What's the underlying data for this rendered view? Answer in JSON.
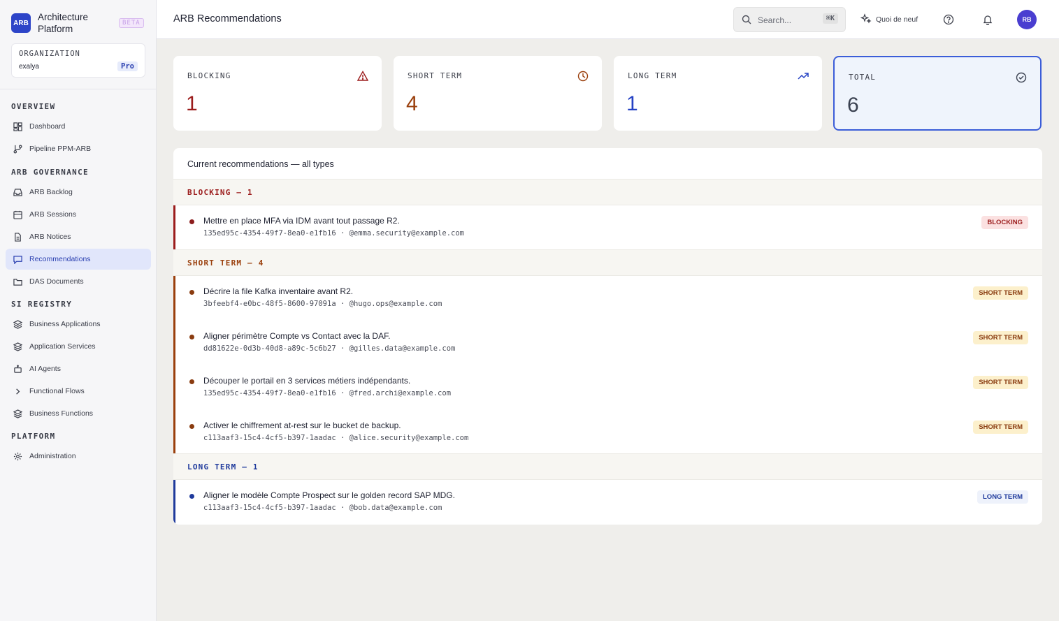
{
  "brand": {
    "logo": "ARB",
    "name": "Architecture Platform",
    "badge": "BETA"
  },
  "org": {
    "label": "ORGANIZATION",
    "name": "exalya",
    "plan": "Pro"
  },
  "sidebar": {
    "sections": [
      {
        "title": "OVERVIEW",
        "items": [
          {
            "label": "Dashboard",
            "icon": "dashboard-icon"
          },
          {
            "label": "Pipeline PPM-ARB",
            "icon": "git-branch-icon"
          }
        ]
      },
      {
        "title": "ARB GOVERNANCE",
        "items": [
          {
            "label": "ARB Backlog",
            "icon": "inbox-icon"
          },
          {
            "label": "ARB Sessions",
            "icon": "calendar-icon"
          },
          {
            "label": "ARB Notices",
            "icon": "document-icon"
          },
          {
            "label": "Recommendations",
            "icon": "message-icon",
            "active": true
          },
          {
            "label": "DAS Documents",
            "icon": "folder-icon"
          }
        ]
      },
      {
        "title": "SI REGISTRY",
        "items": [
          {
            "label": "Business Applications",
            "icon": "layers-icon"
          },
          {
            "label": "Application Services",
            "icon": "layers-icon"
          },
          {
            "label": "AI Agents",
            "icon": "robot-icon"
          },
          {
            "label": "Functional Flows",
            "icon": "chevron-right-icon"
          },
          {
            "label": "Business Functions",
            "icon": "layers-icon"
          }
        ]
      },
      {
        "title": "PLATFORM",
        "items": [
          {
            "label": "Administration",
            "icon": "gear-icon"
          }
        ]
      }
    ]
  },
  "header": {
    "title": "ARB Recommendations",
    "search_placeholder": "Search...",
    "search_shortcut": "⌘K",
    "whats_new": "Quoi de neuf",
    "avatar": "RB"
  },
  "stats": [
    {
      "label": "BLOCKING",
      "value": "1",
      "color": "#9b1c1c",
      "icon": "warning-icon"
    },
    {
      "label": "SHORT TERM",
      "value": "4",
      "color": "#9a3f0c",
      "icon": "clock-icon"
    },
    {
      "label": "LONG TERM",
      "value": "1",
      "color": "#2542c4",
      "icon": "trending-up-icon"
    },
    {
      "label": "TOTAL",
      "value": "6",
      "color": "#3a4150",
      "icon": "check-circle-icon"
    }
  ],
  "panel": {
    "title": "Current recommendations — all types",
    "groups": [
      {
        "header": "BLOCKING — 1",
        "color": "#9b1c1c",
        "tag": "BLOCKING",
        "items": [
          {
            "title": "Mettre en place MFA via IDM avant tout passage R2.",
            "id": "135ed95c-4354-49f7-8ea0-e1fb16",
            "owner": "@emma.security@example.com"
          }
        ]
      },
      {
        "header": "SHORT TERM — 4",
        "color": "#9a3f0c",
        "tag": "SHORT TERM",
        "items": [
          {
            "title": "Décrire la file Kafka inventaire avant R2.",
            "id": "3bfeebf4-e0bc-48f5-8600-97091a",
            "owner": "@hugo.ops@example.com"
          },
          {
            "title": "Aligner périmètre Compte vs Contact avec la DAF.",
            "id": "dd81622e-0d3b-40d8-a89c-5c6b27",
            "owner": "@gilles.data@example.com"
          },
          {
            "title": "Découper le portail en 3 services métiers indépendants.",
            "id": "135ed95c-4354-49f7-8ea0-e1fb16",
            "owner": "@fred.archi@example.com"
          },
          {
            "title": "Activer le chiffrement at-rest sur le bucket de backup.",
            "id": "c113aaf3-15c4-4cf5-b397-1aadac",
            "owner": "@alice.security@example.com"
          }
        ]
      },
      {
        "header": "LONG TERM — 1",
        "color": "#1f3a9c",
        "tag": "LONG TERM",
        "items": [
          {
            "title": "Aligner le modèle Compte Prospect sur le golden record SAP MDG.",
            "id": "c113aaf3-15c4-4cf5-b397-1aadac",
            "owner": "@bob.data@example.com"
          }
        ]
      }
    ]
  }
}
